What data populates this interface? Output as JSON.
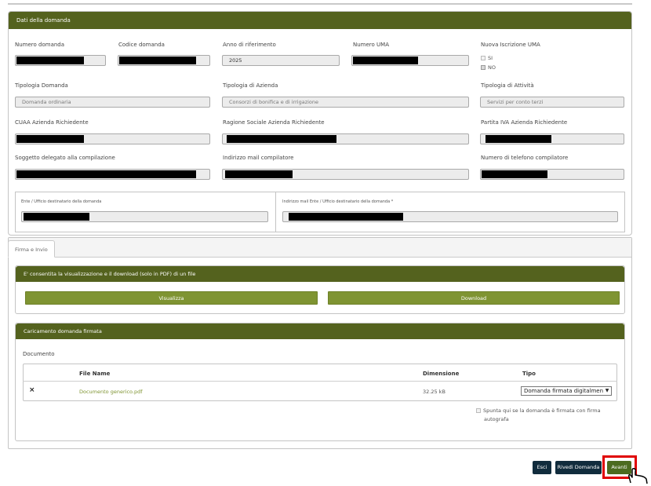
{
  "dati": {
    "header": "Dati della domanda",
    "labels": {
      "numero_domanda": "Numero domanda",
      "codice_domanda": "Codice domanda",
      "anno": "Anno di riferimento",
      "numero_uma": "Numero UMA",
      "nuova_iscrizione": "Nuova Iscrizione UMA",
      "tipologia_domanda": "Tipologia Domanda",
      "tipologia_azienda": "Tipologia di Azienda",
      "tipologia_attivita": "Tipologia di Attività",
      "cuaa": "CUAA Azienda Richiedente",
      "ragione_sociale": "Ragione Sociale Azienda Richiedente",
      "partita_iva": "Partita IVA Azienda Richiedente",
      "soggetto": "Soggetto delegato alla compilazione",
      "mail_compilatore": "Indirizzo mail compilatore",
      "telefono": "Numero di telefono compilatore",
      "ente": "Ente / Ufficio destinatario della domanda",
      "mail_ente": "Indirizzo mail Ente / Ufficio destinatario della domanda *"
    },
    "values": {
      "anno": "2025",
      "tipologia_domanda": "Domanda ordinaria",
      "tipologia_azienda": "Consorzi di bonifica e di irrigazione",
      "tipologia_attivita": "Servizi per conto terzi"
    },
    "iscrizione_options": {
      "si": "SI",
      "no": "NO"
    }
  },
  "tabs": {
    "firma": "Firma e Invio"
  },
  "visualizzazione": {
    "header": "E' consentita la visualizzazione e il download (solo in PDF) di un file",
    "visualizza": "Visualizza",
    "download": "Download"
  },
  "caricamento": {
    "header": "Caricamento domanda firmata",
    "documento_label": "Documento",
    "columns": {
      "file_name": "File Name",
      "dimensione": "Dimensione",
      "tipo": "Tipo"
    },
    "row": {
      "remove_icon": "×",
      "file_name": "Documento generico.pdf",
      "dimensione": "32.25 kB",
      "tipo": "Domanda firmata digitalmente"
    },
    "autografa_line1": "Spunta qui se la domanda è firmata con firma",
    "autografa_line2": "autografa"
  },
  "actions": {
    "esci": "Esci",
    "rivedi": "Rivedi Domanda",
    "avanti": "Avanti"
  },
  "colors": {
    "olive_dark": "#54621e",
    "olive": "#7f9432",
    "navy": "#112c3d",
    "highlight": "#e00000"
  }
}
